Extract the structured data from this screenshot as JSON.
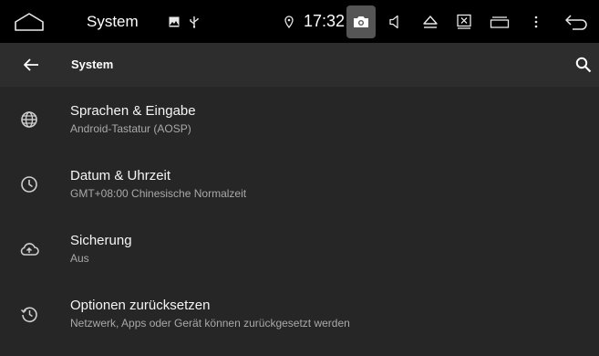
{
  "statusbar": {
    "title": "System",
    "time": "17:32",
    "icons": [
      "home-icon",
      "image-icon",
      "usb-icon",
      "location-pin-icon",
      "camera-icon",
      "volume-icon",
      "eject-icon",
      "close-window-icon",
      "recent-apps-icon",
      "overflow-menu-icon",
      "back-icon"
    ]
  },
  "appbar": {
    "title": "System",
    "back_icon": "arrow-back-icon",
    "search_icon": "search-icon"
  },
  "items": [
    {
      "title": "Sprachen & Eingabe",
      "subtitle": "Android-Tastatur (AOSP)",
      "icon": "globe-icon"
    },
    {
      "title": "Datum & Uhrzeit",
      "subtitle": "GMT+08:00 Chinesische Normalzeit",
      "icon": "clock-icon"
    },
    {
      "title": "Sicherung",
      "subtitle": "Aus",
      "icon": "cloud-upload-icon"
    },
    {
      "title": "Optionen zurücksetzen",
      "subtitle": "Netzwerk, Apps oder Gerät können zurückgesetzt werden",
      "icon": "history-icon"
    }
  ],
  "colors": {
    "statusbar_bg": "#000000",
    "appbar_bg": "#2d2d2d",
    "list_bg": "#262626",
    "primary_text": "#f5f5f5",
    "secondary_text": "#a9a9a9"
  }
}
